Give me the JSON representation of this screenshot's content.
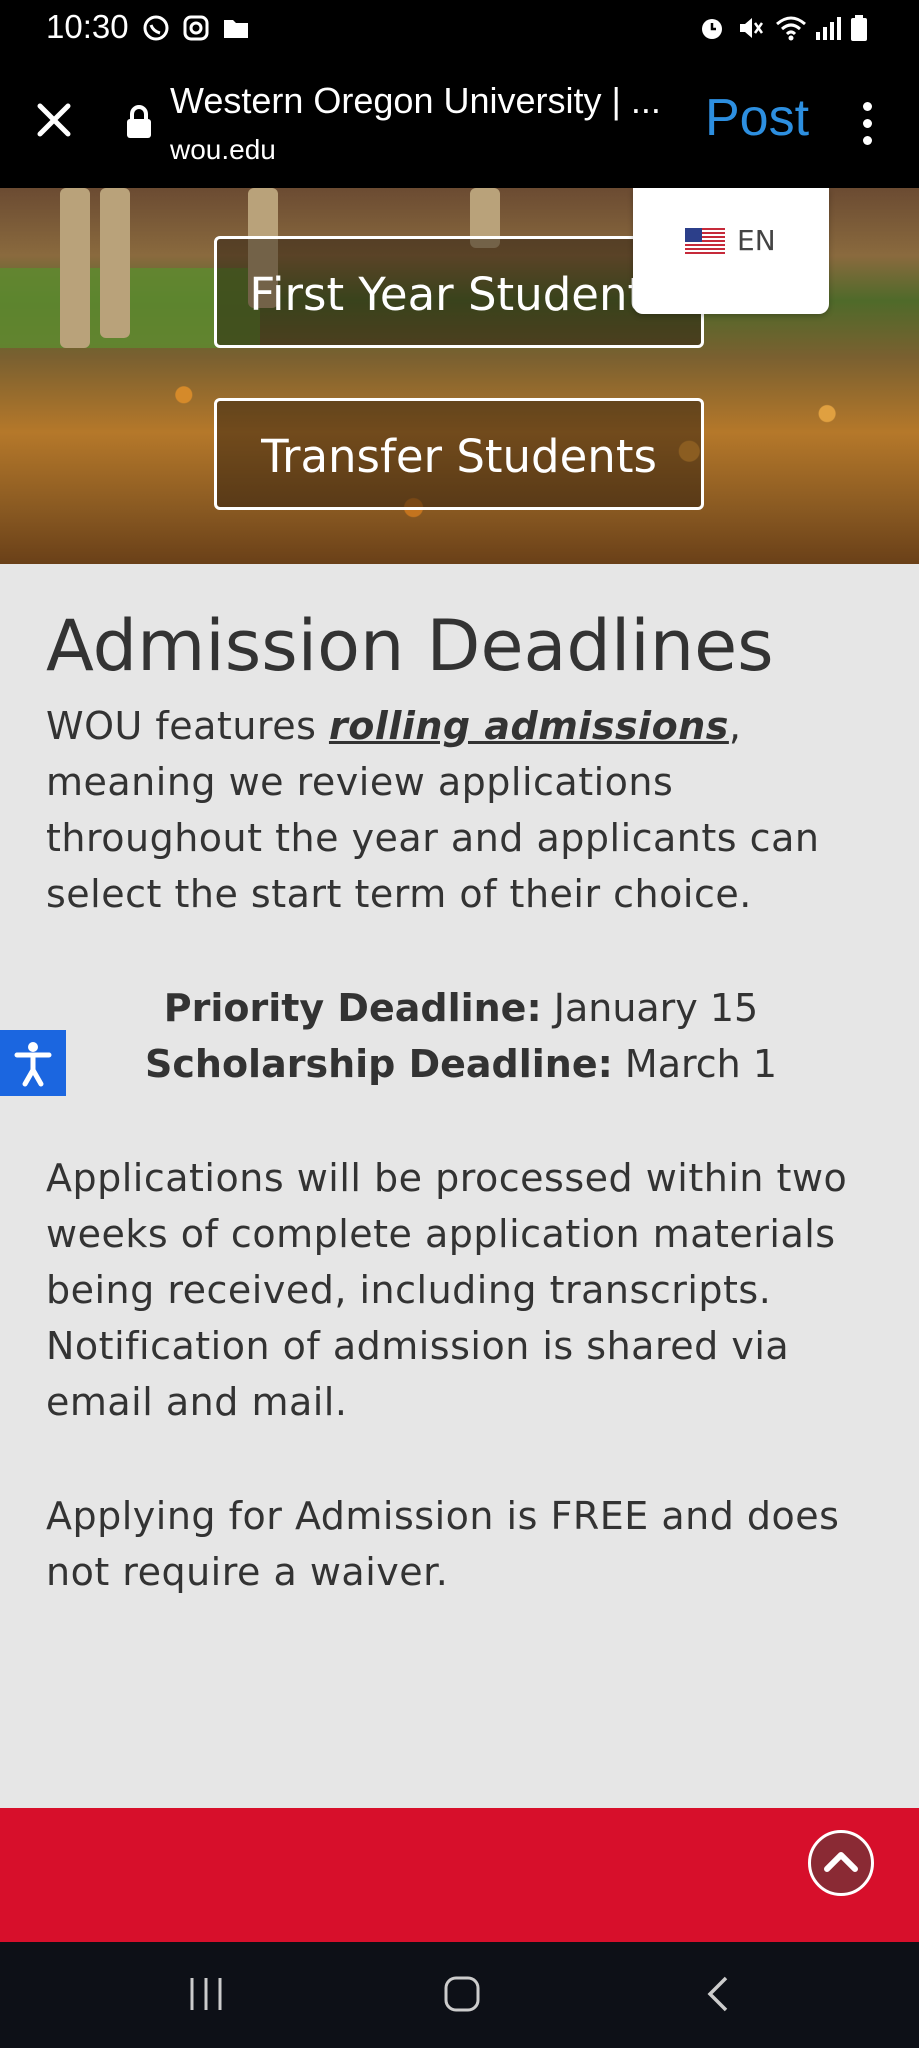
{
  "status_bar": {
    "time": "10:30",
    "left_icons": [
      "whatsapp-icon",
      "instagram-icon",
      "folder-icon"
    ],
    "right_icons": [
      "alarm-icon",
      "mute-icon",
      "wifi-icon",
      "signal-icon",
      "battery-icon"
    ]
  },
  "browser": {
    "title": "Western Oregon University | ...",
    "url": "wou.edu",
    "post_label": "Post",
    "accent": "#2d8fe0"
  },
  "language": {
    "flag": "us-flag-icon",
    "code": "EN"
  },
  "hero": {
    "buttons": [
      "First Year Students",
      "Transfer Students"
    ]
  },
  "main": {
    "heading": "Admission Deadlines",
    "intro_pre": "WOU features ",
    "intro_link": "rolling admissions",
    "intro_post": ", meaning we review applications throughout the year and applicants can select the start term of their choice.",
    "deadlines": [
      {
        "label": "Priority Deadline:",
        "value": " January 15"
      },
      {
        "label": "Scholarship Deadline:",
        "value": " March 1"
      }
    ],
    "para2": "Applications will be processed within two weeks of complete application materials being received, including transcripts. Notification of admission is shared via email and mail.",
    "para3": "Applying for Admission is FREE and does not require a waiver."
  },
  "footer": {
    "color": "#d70f2b"
  }
}
